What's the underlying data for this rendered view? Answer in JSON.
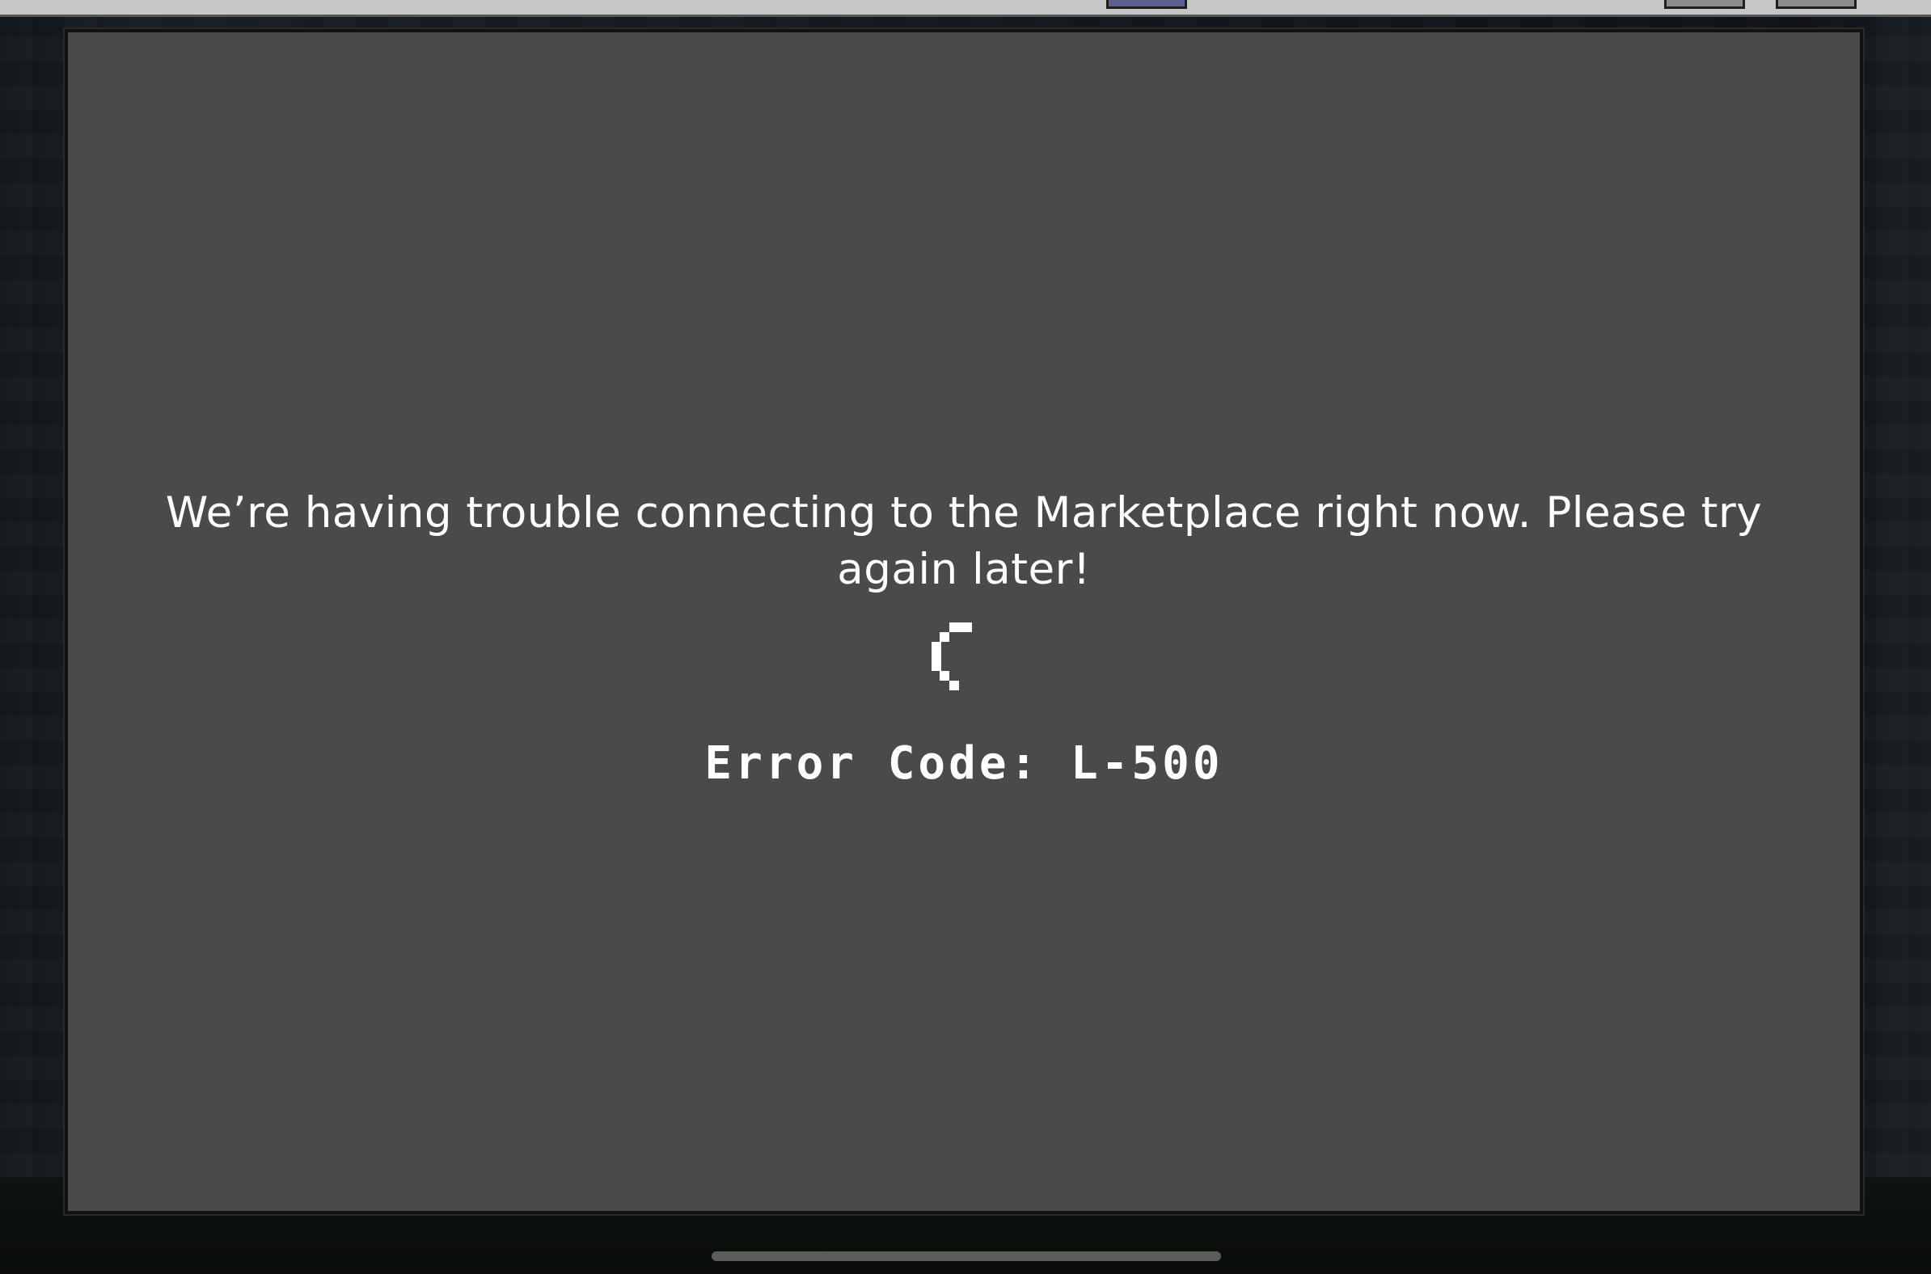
{
  "dialog": {
    "message": "We’re having trouble connecting to the Marketplace right now. Please try again later!",
    "error_code": "Error Code: L-500"
  },
  "icons": {
    "loading": "loading-spinner-icon"
  },
  "colors": {
    "panel_background": "#4a4a4a",
    "text": "#ffffff",
    "top_bar": "#c6c6c6"
  }
}
